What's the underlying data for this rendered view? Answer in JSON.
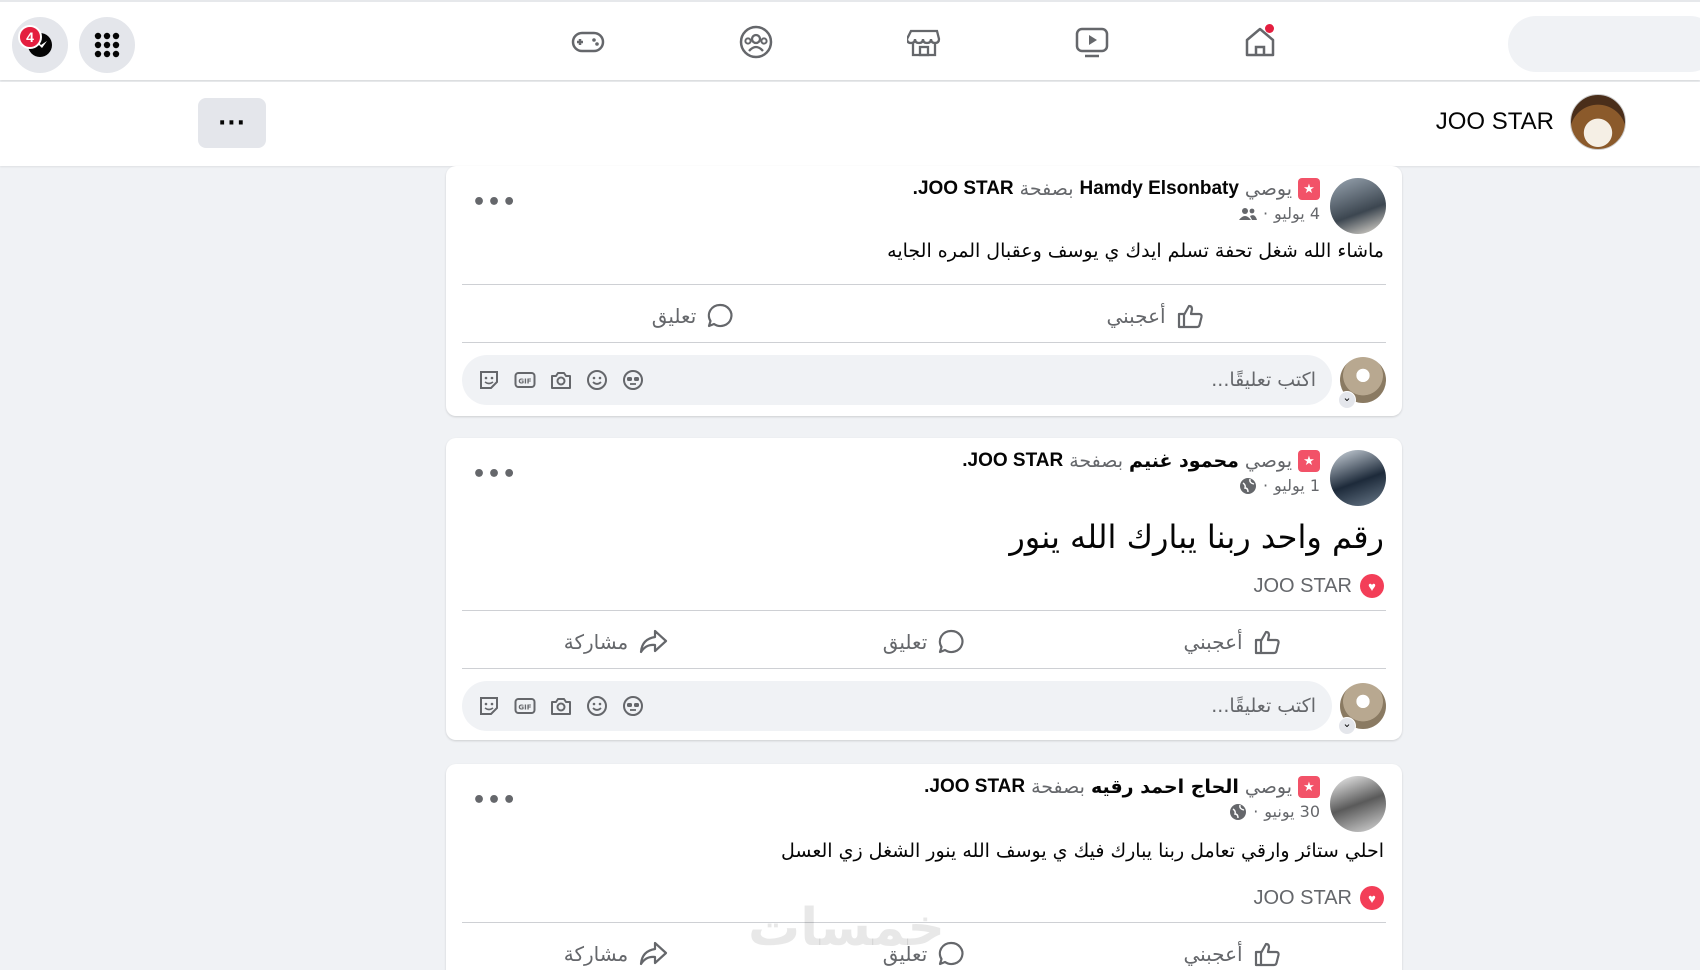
{
  "topbar": {
    "messenger_badge": "4",
    "nav_icons": [
      "gaming-icon",
      "groups-icon",
      "marketplace-icon",
      "watch-icon",
      "home-icon"
    ]
  },
  "page": {
    "name": "JOO STAR",
    "more_label": "···"
  },
  "strings": {
    "recommends": "يوصي",
    "page_prefix": "بصفحة",
    "like": "أعجبني",
    "comment": "تعليق",
    "share": "مشاركة",
    "comment_placeholder": "اكتب تعليقًا...",
    "more_dots": "•••"
  },
  "posts": [
    {
      "author": "Hamdy Elsonbaty",
      "page": "JOO STAR.",
      "date": "4 يوليو",
      "audience": "friends-icon",
      "text": "ماشاء الله شغل تحفة تسلم ايدك ي يوسف وعقبال المره الجايه",
      "reaction": ""
    },
    {
      "author": "محمود غنيم",
      "page": "JOO STAR.",
      "date": "1 يوليو",
      "audience": "public-icon",
      "text": "رقم واحد ربنا يبارك الله ينور",
      "reaction": "JOO STAR"
    },
    {
      "author": "الحاج احمد رقيه",
      "page": "JOO STAR.",
      "date": "30 يونيو",
      "audience": "public-icon",
      "text": "احلي ستائر وارقي تعامل ربنا يبارك فيك ي يوسف الله ينور الشغل زي العسل",
      "reaction": "JOO STAR"
    }
  ],
  "watermark": "خمسات",
  "colors": {
    "accent_red": "#e41e3f",
    "love_red": "#f33e58",
    "recommend_pink": "#f25268",
    "text_grey": "#65676b",
    "background": "#f0f2f5"
  }
}
